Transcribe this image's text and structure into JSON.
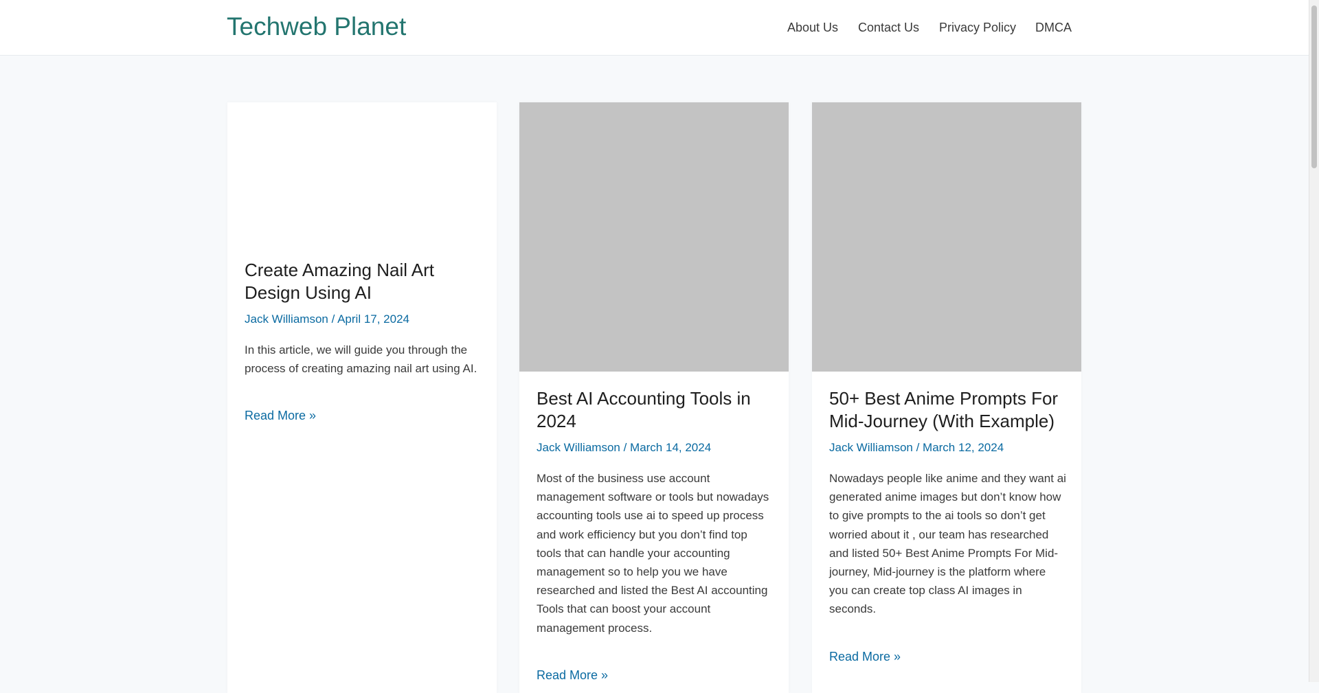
{
  "header": {
    "site_title": "Techweb Planet",
    "nav": [
      "About Us",
      "Contact Us",
      "Privacy Policy",
      "DMCA"
    ]
  },
  "posts": [
    {
      "title": "Create Amazing Nail Art Design Using AI",
      "author": "Jack Williamson",
      "separator": " / ",
      "date": "April 17, 2024",
      "excerpt": "In this article, we will guide you through the process of creating amazing nail art using AI.",
      "read_more": "Read More »",
      "has_image": false
    },
    {
      "title": "Best AI Accounting Tools in 2024",
      "author": "Jack Williamson",
      "separator": " / ",
      "date": "March 14, 2024",
      "excerpt": "Most of the business use account management software or tools but nowadays accounting tools use ai to speed up process and work efficiency but you don’t find top tools that can handle your accounting management so to help you we have researched and listed the Best AI accounting Tools that can boost your account management process.",
      "read_more": "Read More »",
      "has_image": true
    },
    {
      "title": "50+ Best Anime Prompts For Mid-Journey (With Example)",
      "author": "Jack Williamson",
      "separator": " / ",
      "date": "March 12, 2024",
      "excerpt": "Nowadays people like anime and they want ai generated anime images but don’t know how to give prompts to the ai tools so don’t get worried about it , our team has researched and listed 50+ Best Anime Prompts For Mid-journey, Mid-journey is the platform where you can create top class AI images in seconds.",
      "read_more": "Read More »",
      "has_image": true
    }
  ],
  "colors": {
    "brand": "#23756f",
    "link": "#0a6aa1",
    "image_placeholder": "#c3c3c3"
  }
}
